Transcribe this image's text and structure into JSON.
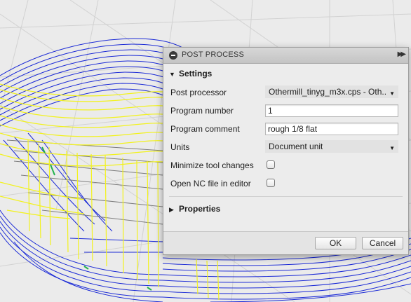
{
  "dialog": {
    "title": "POST PROCESS",
    "settings_label": "Settings",
    "properties_label": "Properties",
    "fields": {
      "post_processor": {
        "label": "Post processor",
        "value": "Othermill_tinyg_m3x.cps - Oth..."
      },
      "program_number": {
        "label": "Program number",
        "value": "1"
      },
      "program_comment": {
        "label": "Program comment",
        "value": "rough 1/8 flat"
      },
      "units": {
        "label": "Units",
        "value": "Document unit"
      },
      "minimize_tool_changes": {
        "label": "Minimize tool changes",
        "checked": false
      },
      "open_nc_file": {
        "label": "Open NC file in editor",
        "checked": false
      }
    },
    "buttons": {
      "ok": "OK",
      "cancel": "Cancel"
    }
  },
  "icons": {
    "title": "minus-circle-icon",
    "collapse": "double-chevron-right-icon",
    "settings_toggle": "triangle-down-icon",
    "properties_toggle": "triangle-right-icon",
    "select_arrow": "triangle-down-icon"
  },
  "colors": {
    "toolpath_blue": "#1b2ad6",
    "toolpath_yellow": "#f2f21c",
    "toolpath_green": "#22b14c",
    "grid": "#cfcfcf"
  }
}
